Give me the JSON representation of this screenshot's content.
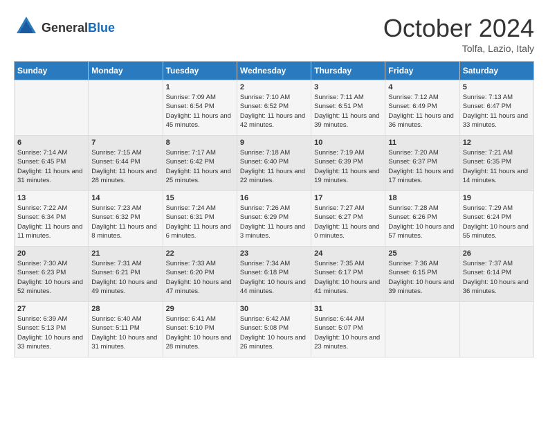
{
  "header": {
    "logo_general": "General",
    "logo_blue": "Blue",
    "month": "October 2024",
    "location": "Tolfa, Lazio, Italy"
  },
  "days_of_week": [
    "Sunday",
    "Monday",
    "Tuesday",
    "Wednesday",
    "Thursday",
    "Friday",
    "Saturday"
  ],
  "weeks": [
    [
      {
        "day": "",
        "content": ""
      },
      {
        "day": "",
        "content": ""
      },
      {
        "day": "1",
        "content": "Sunrise: 7:09 AM\nSunset: 6:54 PM\nDaylight: 11 hours and 45 minutes."
      },
      {
        "day": "2",
        "content": "Sunrise: 7:10 AM\nSunset: 6:52 PM\nDaylight: 11 hours and 42 minutes."
      },
      {
        "day": "3",
        "content": "Sunrise: 7:11 AM\nSunset: 6:51 PM\nDaylight: 11 hours and 39 minutes."
      },
      {
        "day": "4",
        "content": "Sunrise: 7:12 AM\nSunset: 6:49 PM\nDaylight: 11 hours and 36 minutes."
      },
      {
        "day": "5",
        "content": "Sunrise: 7:13 AM\nSunset: 6:47 PM\nDaylight: 11 hours and 33 minutes."
      }
    ],
    [
      {
        "day": "6",
        "content": "Sunrise: 7:14 AM\nSunset: 6:45 PM\nDaylight: 11 hours and 31 minutes."
      },
      {
        "day": "7",
        "content": "Sunrise: 7:15 AM\nSunset: 6:44 PM\nDaylight: 11 hours and 28 minutes."
      },
      {
        "day": "8",
        "content": "Sunrise: 7:17 AM\nSunset: 6:42 PM\nDaylight: 11 hours and 25 minutes."
      },
      {
        "day": "9",
        "content": "Sunrise: 7:18 AM\nSunset: 6:40 PM\nDaylight: 11 hours and 22 minutes."
      },
      {
        "day": "10",
        "content": "Sunrise: 7:19 AM\nSunset: 6:39 PM\nDaylight: 11 hours and 19 minutes."
      },
      {
        "day": "11",
        "content": "Sunrise: 7:20 AM\nSunset: 6:37 PM\nDaylight: 11 hours and 17 minutes."
      },
      {
        "day": "12",
        "content": "Sunrise: 7:21 AM\nSunset: 6:35 PM\nDaylight: 11 hours and 14 minutes."
      }
    ],
    [
      {
        "day": "13",
        "content": "Sunrise: 7:22 AM\nSunset: 6:34 PM\nDaylight: 11 hours and 11 minutes."
      },
      {
        "day": "14",
        "content": "Sunrise: 7:23 AM\nSunset: 6:32 PM\nDaylight: 11 hours and 8 minutes."
      },
      {
        "day": "15",
        "content": "Sunrise: 7:24 AM\nSunset: 6:31 PM\nDaylight: 11 hours and 6 minutes."
      },
      {
        "day": "16",
        "content": "Sunrise: 7:26 AM\nSunset: 6:29 PM\nDaylight: 11 hours and 3 minutes."
      },
      {
        "day": "17",
        "content": "Sunrise: 7:27 AM\nSunset: 6:27 PM\nDaylight: 11 hours and 0 minutes."
      },
      {
        "day": "18",
        "content": "Sunrise: 7:28 AM\nSunset: 6:26 PM\nDaylight: 10 hours and 57 minutes."
      },
      {
        "day": "19",
        "content": "Sunrise: 7:29 AM\nSunset: 6:24 PM\nDaylight: 10 hours and 55 minutes."
      }
    ],
    [
      {
        "day": "20",
        "content": "Sunrise: 7:30 AM\nSunset: 6:23 PM\nDaylight: 10 hours and 52 minutes."
      },
      {
        "day": "21",
        "content": "Sunrise: 7:31 AM\nSunset: 6:21 PM\nDaylight: 10 hours and 49 minutes."
      },
      {
        "day": "22",
        "content": "Sunrise: 7:33 AM\nSunset: 6:20 PM\nDaylight: 10 hours and 47 minutes."
      },
      {
        "day": "23",
        "content": "Sunrise: 7:34 AM\nSunset: 6:18 PM\nDaylight: 10 hours and 44 minutes."
      },
      {
        "day": "24",
        "content": "Sunrise: 7:35 AM\nSunset: 6:17 PM\nDaylight: 10 hours and 41 minutes."
      },
      {
        "day": "25",
        "content": "Sunrise: 7:36 AM\nSunset: 6:15 PM\nDaylight: 10 hours and 39 minutes."
      },
      {
        "day": "26",
        "content": "Sunrise: 7:37 AM\nSunset: 6:14 PM\nDaylight: 10 hours and 36 minutes."
      }
    ],
    [
      {
        "day": "27",
        "content": "Sunrise: 6:39 AM\nSunset: 5:13 PM\nDaylight: 10 hours and 33 minutes."
      },
      {
        "day": "28",
        "content": "Sunrise: 6:40 AM\nSunset: 5:11 PM\nDaylight: 10 hours and 31 minutes."
      },
      {
        "day": "29",
        "content": "Sunrise: 6:41 AM\nSunset: 5:10 PM\nDaylight: 10 hours and 28 minutes."
      },
      {
        "day": "30",
        "content": "Sunrise: 6:42 AM\nSunset: 5:08 PM\nDaylight: 10 hours and 26 minutes."
      },
      {
        "day": "31",
        "content": "Sunrise: 6:44 AM\nSunset: 5:07 PM\nDaylight: 10 hours and 23 minutes."
      },
      {
        "day": "",
        "content": ""
      },
      {
        "day": "",
        "content": ""
      }
    ]
  ]
}
